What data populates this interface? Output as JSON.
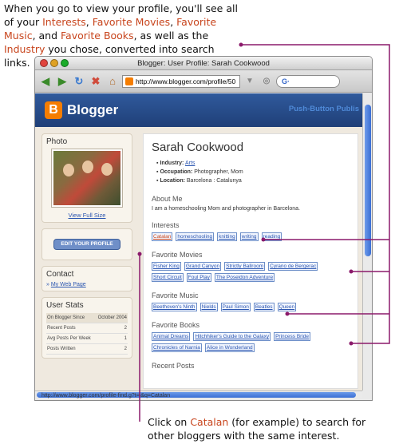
{
  "captions": {
    "top_pre": "When you go to view your profile, you'll see all of your ",
    "top_interests": "Interests",
    "top_sep1": ", ",
    "top_movies": "Favorite Movies",
    "top_sep2": ", ",
    "top_music": "Favorite Music",
    "top_sep3": ", and ",
    "top_books": "Favorite Books",
    "top_mid": ", as well as the ",
    "top_industry": "Industry",
    "top_post": " you chose, converted into search links.",
    "bottom_pre": "Click on ",
    "bottom_catalan": "Catalan",
    "bottom_post": " (for example) to search for other bloggers with the same interest."
  },
  "window": {
    "title": "Blogger: User Profile: Sarah Cookwood",
    "url": "http://www.blogger.com/profile/50",
    "search_label": "G·",
    "status_url": "http://www.blogger.com/profile-find.g?t=i&q=Catalan"
  },
  "header": {
    "logo_letter": "B",
    "brand": "Blogger",
    "tagline": "Push-Button Publis"
  },
  "sidebar": {
    "photo_title": "Photo",
    "full_size": "View Full Size",
    "edit_profile": "EDIT YOUR PROFILE",
    "contact_title": "Contact",
    "contact_link": "My Web Page",
    "stats_title": "User Stats",
    "stats": [
      {
        "label": "On Blogger Since",
        "value": "October 2004"
      },
      {
        "label": "Recent Posts",
        "value": "2"
      },
      {
        "label": "Avg Posts Per Week",
        "value": "1"
      },
      {
        "label": "Posts Written",
        "value": "2"
      }
    ]
  },
  "profile": {
    "name": "Sarah Cookwood",
    "industry_label": "Industry:",
    "industry_value": "Arts",
    "occupation_label": "Occupation:",
    "occupation_value": "Photographer, Mom",
    "location_label": "Location:",
    "location_value": "Barcelona : Catalunya",
    "about_title": "About Me",
    "about_text": "I am a homeschooling Mom and photographer in Barcelona.",
    "interests_title": "Interests",
    "interests": [
      "Catalan",
      "homeschooling",
      "knitting",
      "writing",
      "reading"
    ],
    "movies_title": "Favorite Movies",
    "movies": [
      "Fisher King",
      "Grand Canyon",
      "Strictly Ballroom",
      "Cyrano de Bergerac",
      "Short Circuit",
      "Foul Play",
      "The Poseidon Adventure"
    ],
    "music_title": "Favorite Music",
    "music": [
      "Beethoven's Ninth",
      "Nields",
      "Paul Simon",
      "Beatles",
      "Queen"
    ],
    "books_title": "Favorite Books",
    "books": [
      "Animal Dreams",
      "Hitchhiker's Guide to the Galaxy",
      "Princess Bride",
      "Chronicles of Narnia",
      "Alice in Wonderland"
    ],
    "recent_posts_title": "Recent Posts"
  },
  "colors": {
    "highlight": "#c8451d",
    "callout_line": "#8b1a6b",
    "link": "#2a55b0"
  }
}
